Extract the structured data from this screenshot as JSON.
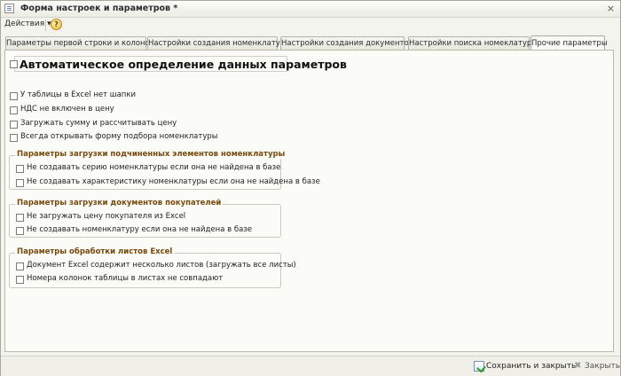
{
  "window": {
    "title": "Форма настроек и параметров *",
    "close_symbol": "×"
  },
  "toolbar": {
    "actions_label": "Действия",
    "actions_arrow": "▾",
    "help_symbol": "?"
  },
  "tabs": [
    {
      "label": "Параметры первой строки и колонок",
      "active": false
    },
    {
      "label": "Настройки создания номенклатуры",
      "active": false
    },
    {
      "label": "Настройки создания документов",
      "active": false
    },
    {
      "label": "Настройки поиска номеклатуры",
      "active": false
    },
    {
      "label": "Прочие параметры",
      "active": true
    }
  ],
  "main": {
    "auto_detect_label": "Автоматическое определение данных параметров",
    "options": [
      "У таблицы в Excel нет шапки",
      "НДС не включен в цену",
      "Загружать сумму и рассчитывать цену",
      "Всегда открывать форму подбора номенклатуры"
    ],
    "groups": [
      {
        "title": "Параметры загрузки подчиненных элементов номенклатуры",
        "items": [
          "Не создавать серию номенклатуры если она не найдена в базе",
          "Не создавать характеристику номенклатуры если она не найдена в базе"
        ]
      },
      {
        "title": "Параметры загрузки документов покупателей",
        "items": [
          "Не загружать цену покупателя из Excel",
          "Не создавать номенклатуру если она не найдена в базе"
        ]
      },
      {
        "title": "Параметры обработки листов Excel",
        "items": [
          "Документ Excel содержит несколько листов (загружать все листы)",
          "Номера колонок таблицы в листах не совпадают"
        ]
      }
    ]
  },
  "footer": {
    "save_close_label": "Сохранить и закрыть",
    "close_label": "Закрыть"
  },
  "colors": {
    "group_title": "#7a4a0d",
    "panel_bg": "#fbfbf8"
  }
}
